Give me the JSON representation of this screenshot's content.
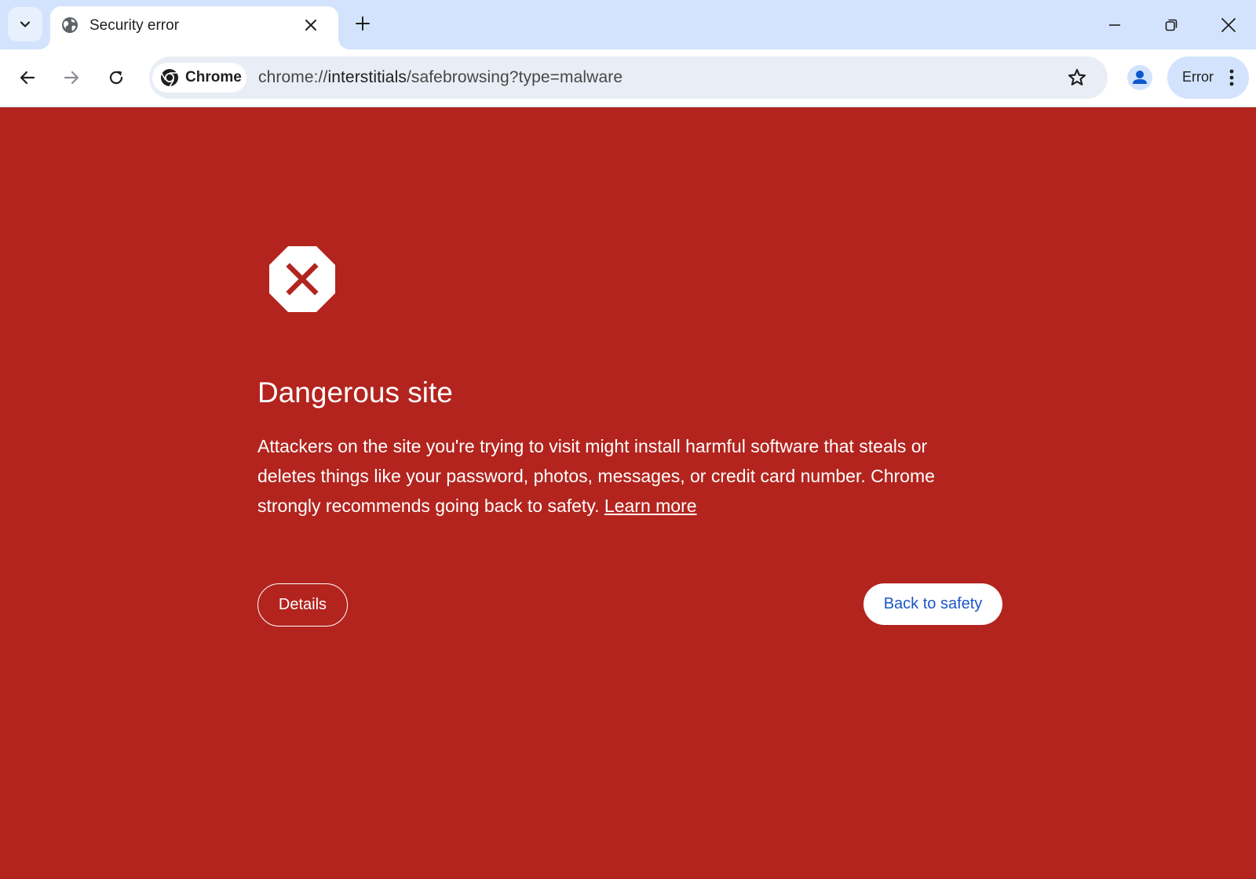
{
  "tab": {
    "title": "Security error"
  },
  "toolbar": {
    "chip_label": "Chrome",
    "url_prefix": "chrome://",
    "url_host": "interstitials",
    "url_rest": "/safebrowsing?type=malware",
    "error_label": "Error"
  },
  "interstitial": {
    "heading": "Dangerous site",
    "body": "Attackers on the site you're trying to visit might install harmful software that steals or deletes things like your password, photos, messages, or credit card number. Chrome strongly recommends going back to safety. ",
    "learn_more": "Learn more",
    "details_label": "Details",
    "back_label": "Back to safety"
  },
  "colors": {
    "page_background": "#b3241e",
    "tabstrip_background": "#d3e3fd",
    "omnibox_background": "#e9eef6",
    "primary_button_text": "#1a57c4"
  },
  "icons": {
    "tab_search": "chevron-down-icon",
    "favicon": "globe-icon",
    "tab_close": "close-icon",
    "new_tab": "plus-icon",
    "minimize": "minimize-icon",
    "restore": "restore-icon",
    "close_window": "close-icon",
    "back": "arrow-left-icon",
    "forward": "arrow-right-icon",
    "reload": "reload-icon",
    "chrome_logo": "chrome-logo-icon",
    "bookmark": "star-icon",
    "profile": "person-icon",
    "menu": "kebab-menu-icon",
    "danger": "octagon-x-icon"
  }
}
